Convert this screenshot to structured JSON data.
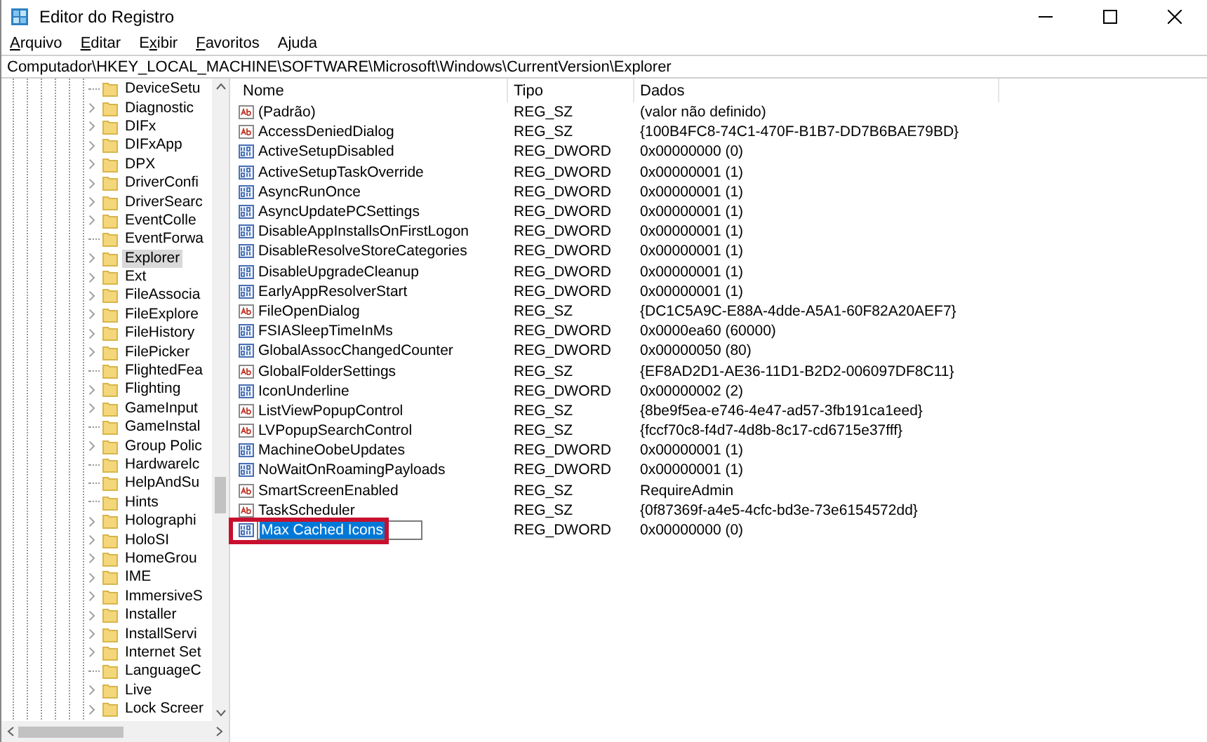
{
  "window": {
    "title": "Editor do Registro"
  },
  "menu": [
    {
      "key": "A",
      "post": "rquivo"
    },
    {
      "key": "E",
      "post": "ditar"
    },
    {
      "pre": "E",
      "key": "x",
      "post": "ibir"
    },
    {
      "key": "F",
      "post": "avoritos"
    },
    {
      "pre": "A",
      "key": "j",
      "post": "uda"
    }
  ],
  "address": "Computador\\HKEY_LOCAL_MACHINE\\SOFTWARE\\Microsoft\\Windows\\CurrentVersion\\Explorer",
  "tree": [
    {
      "label": "DeviceSetu",
      "expander": false,
      "selected": false
    },
    {
      "label": "Diagnostic",
      "expander": true,
      "selected": false
    },
    {
      "label": "DIFx",
      "expander": true,
      "selected": false
    },
    {
      "label": "DIFxApp",
      "expander": true,
      "selected": false
    },
    {
      "label": "DPX",
      "expander": true,
      "selected": false
    },
    {
      "label": "DriverConfi",
      "expander": true,
      "selected": false
    },
    {
      "label": "DriverSearc",
      "expander": true,
      "selected": false
    },
    {
      "label": "EventColle",
      "expander": true,
      "selected": false
    },
    {
      "label": "EventForwa",
      "expander": false,
      "selected": false
    },
    {
      "label": "Explorer",
      "expander": true,
      "selected": true
    },
    {
      "label": "Ext",
      "expander": true,
      "selected": false
    },
    {
      "label": "FileAssocia",
      "expander": true,
      "selected": false
    },
    {
      "label": "FileExplore",
      "expander": true,
      "selected": false
    },
    {
      "label": "FileHistory",
      "expander": true,
      "selected": false
    },
    {
      "label": "FilePicker",
      "expander": true,
      "selected": false
    },
    {
      "label": "FlightedFea",
      "expander": false,
      "selected": false
    },
    {
      "label": "Flighting",
      "expander": true,
      "selected": false
    },
    {
      "label": "GameInput",
      "expander": true,
      "selected": false
    },
    {
      "label": "GameInstal",
      "expander": false,
      "selected": false
    },
    {
      "label": "Group Polic",
      "expander": true,
      "selected": false
    },
    {
      "label": "Hardwarelc",
      "expander": false,
      "selected": false
    },
    {
      "label": "HelpAndSu",
      "expander": false,
      "selected": false
    },
    {
      "label": "Hints",
      "expander": false,
      "selected": false
    },
    {
      "label": "Holographi",
      "expander": true,
      "selected": false
    },
    {
      "label": "HoloSI",
      "expander": true,
      "selected": false
    },
    {
      "label": "HomeGrou",
      "expander": true,
      "selected": false
    },
    {
      "label": "IME",
      "expander": true,
      "selected": false
    },
    {
      "label": "ImmersiveS",
      "expander": true,
      "selected": false
    },
    {
      "label": "Installer",
      "expander": true,
      "selected": false
    },
    {
      "label": "InstallServi",
      "expander": true,
      "selected": false
    },
    {
      "label": "Internet Set",
      "expander": true,
      "selected": false
    },
    {
      "label": "LanguageC",
      "expander": false,
      "selected": false
    },
    {
      "label": "Live",
      "expander": true,
      "selected": false
    },
    {
      "label": "Lock Screer",
      "expander": true,
      "selected": false
    }
  ],
  "table": {
    "columns": [
      "Nome",
      "Tipo",
      "Dados"
    ],
    "rows": [
      {
        "kind": "sz",
        "name": "(Padrão)",
        "type": "REG_SZ",
        "data": "(valor não definido)",
        "editing": false,
        "highlighted": false
      },
      {
        "kind": "sz",
        "name": "AccessDeniedDialog",
        "type": "REG_SZ",
        "data": "{100B4FC8-74C1-470F-B1B7-DD7B6BAE79BD}",
        "editing": false,
        "highlighted": false
      },
      {
        "kind": "dword",
        "name": "ActiveSetupDisabled",
        "type": "REG_DWORD",
        "data": "0x00000000 (0)",
        "editing": false,
        "highlighted": false
      },
      {
        "kind": "dword",
        "name": "ActiveSetupTaskOverride",
        "type": "REG_DWORD",
        "data": "0x00000001 (1)",
        "editing": false,
        "highlighted": false
      },
      {
        "kind": "dword",
        "name": "AsyncRunOnce",
        "type": "REG_DWORD",
        "data": "0x00000001 (1)",
        "editing": false,
        "highlighted": false
      },
      {
        "kind": "dword",
        "name": "AsyncUpdatePCSettings",
        "type": "REG_DWORD",
        "data": "0x00000001 (1)",
        "editing": false,
        "highlighted": false
      },
      {
        "kind": "dword",
        "name": "DisableAppInstallsOnFirstLogon",
        "type": "REG_DWORD",
        "data": "0x00000001 (1)",
        "editing": false,
        "highlighted": false
      },
      {
        "kind": "dword",
        "name": "DisableResolveStoreCategories",
        "type": "REG_DWORD",
        "data": "0x00000001 (1)",
        "editing": false,
        "highlighted": false
      },
      {
        "kind": "dword",
        "name": "DisableUpgradeCleanup",
        "type": "REG_DWORD",
        "data": "0x00000001 (1)",
        "editing": false,
        "highlighted": false
      },
      {
        "kind": "dword",
        "name": "EarlyAppResolverStart",
        "type": "REG_DWORD",
        "data": "0x00000001 (1)",
        "editing": false,
        "highlighted": false
      },
      {
        "kind": "sz",
        "name": "FileOpenDialog",
        "type": "REG_SZ",
        "data": "{DC1C5A9C-E88A-4dde-A5A1-60F82A20AEF7}",
        "editing": false,
        "highlighted": false
      },
      {
        "kind": "dword",
        "name": "FSIASleepTimeInMs",
        "type": "REG_DWORD",
        "data": "0x0000ea60 (60000)",
        "editing": false,
        "highlighted": false
      },
      {
        "kind": "dword",
        "name": "GlobalAssocChangedCounter",
        "type": "REG_DWORD",
        "data": "0x00000050 (80)",
        "editing": false,
        "highlighted": false
      },
      {
        "kind": "sz",
        "name": "GlobalFolderSettings",
        "type": "REG_SZ",
        "data": "{EF8AD2D1-AE36-11D1-B2D2-006097DF8C11}",
        "editing": false,
        "highlighted": false
      },
      {
        "kind": "dword",
        "name": "IconUnderline",
        "type": "REG_DWORD",
        "data": "0x00000002 (2)",
        "editing": false,
        "highlighted": false
      },
      {
        "kind": "sz",
        "name": "ListViewPopupControl",
        "type": "REG_SZ",
        "data": "{8be9f5ea-e746-4e47-ad57-3fb191ca1eed}",
        "editing": false,
        "highlighted": false
      },
      {
        "kind": "sz",
        "name": "LVPopupSearchControl",
        "type": "REG_SZ",
        "data": "{fccf70c8-f4d7-4d8b-8c17-cd6715e37fff}",
        "editing": false,
        "highlighted": false
      },
      {
        "kind": "dword",
        "name": "MachineOobeUpdates",
        "type": "REG_DWORD",
        "data": "0x00000001 (1)",
        "editing": false,
        "highlighted": false
      },
      {
        "kind": "dword",
        "name": "NoWaitOnRoamingPayloads",
        "type": "REG_DWORD",
        "data": "0x00000001 (1)",
        "editing": false,
        "highlighted": false
      },
      {
        "kind": "sz",
        "name": "SmartScreenEnabled",
        "type": "REG_SZ",
        "data": "RequireAdmin",
        "editing": false,
        "highlighted": false
      },
      {
        "kind": "sz",
        "name": "TaskScheduler",
        "type": "REG_SZ",
        "data": "{0f87369f-a4e5-4cfc-bd3e-73e6154572dd}",
        "editing": false,
        "highlighted": false
      },
      {
        "kind": "dword",
        "name": "Max Cached Icons",
        "type": "REG_DWORD",
        "data": "0x00000000 (0)",
        "editing": true,
        "highlighted": true
      }
    ]
  }
}
